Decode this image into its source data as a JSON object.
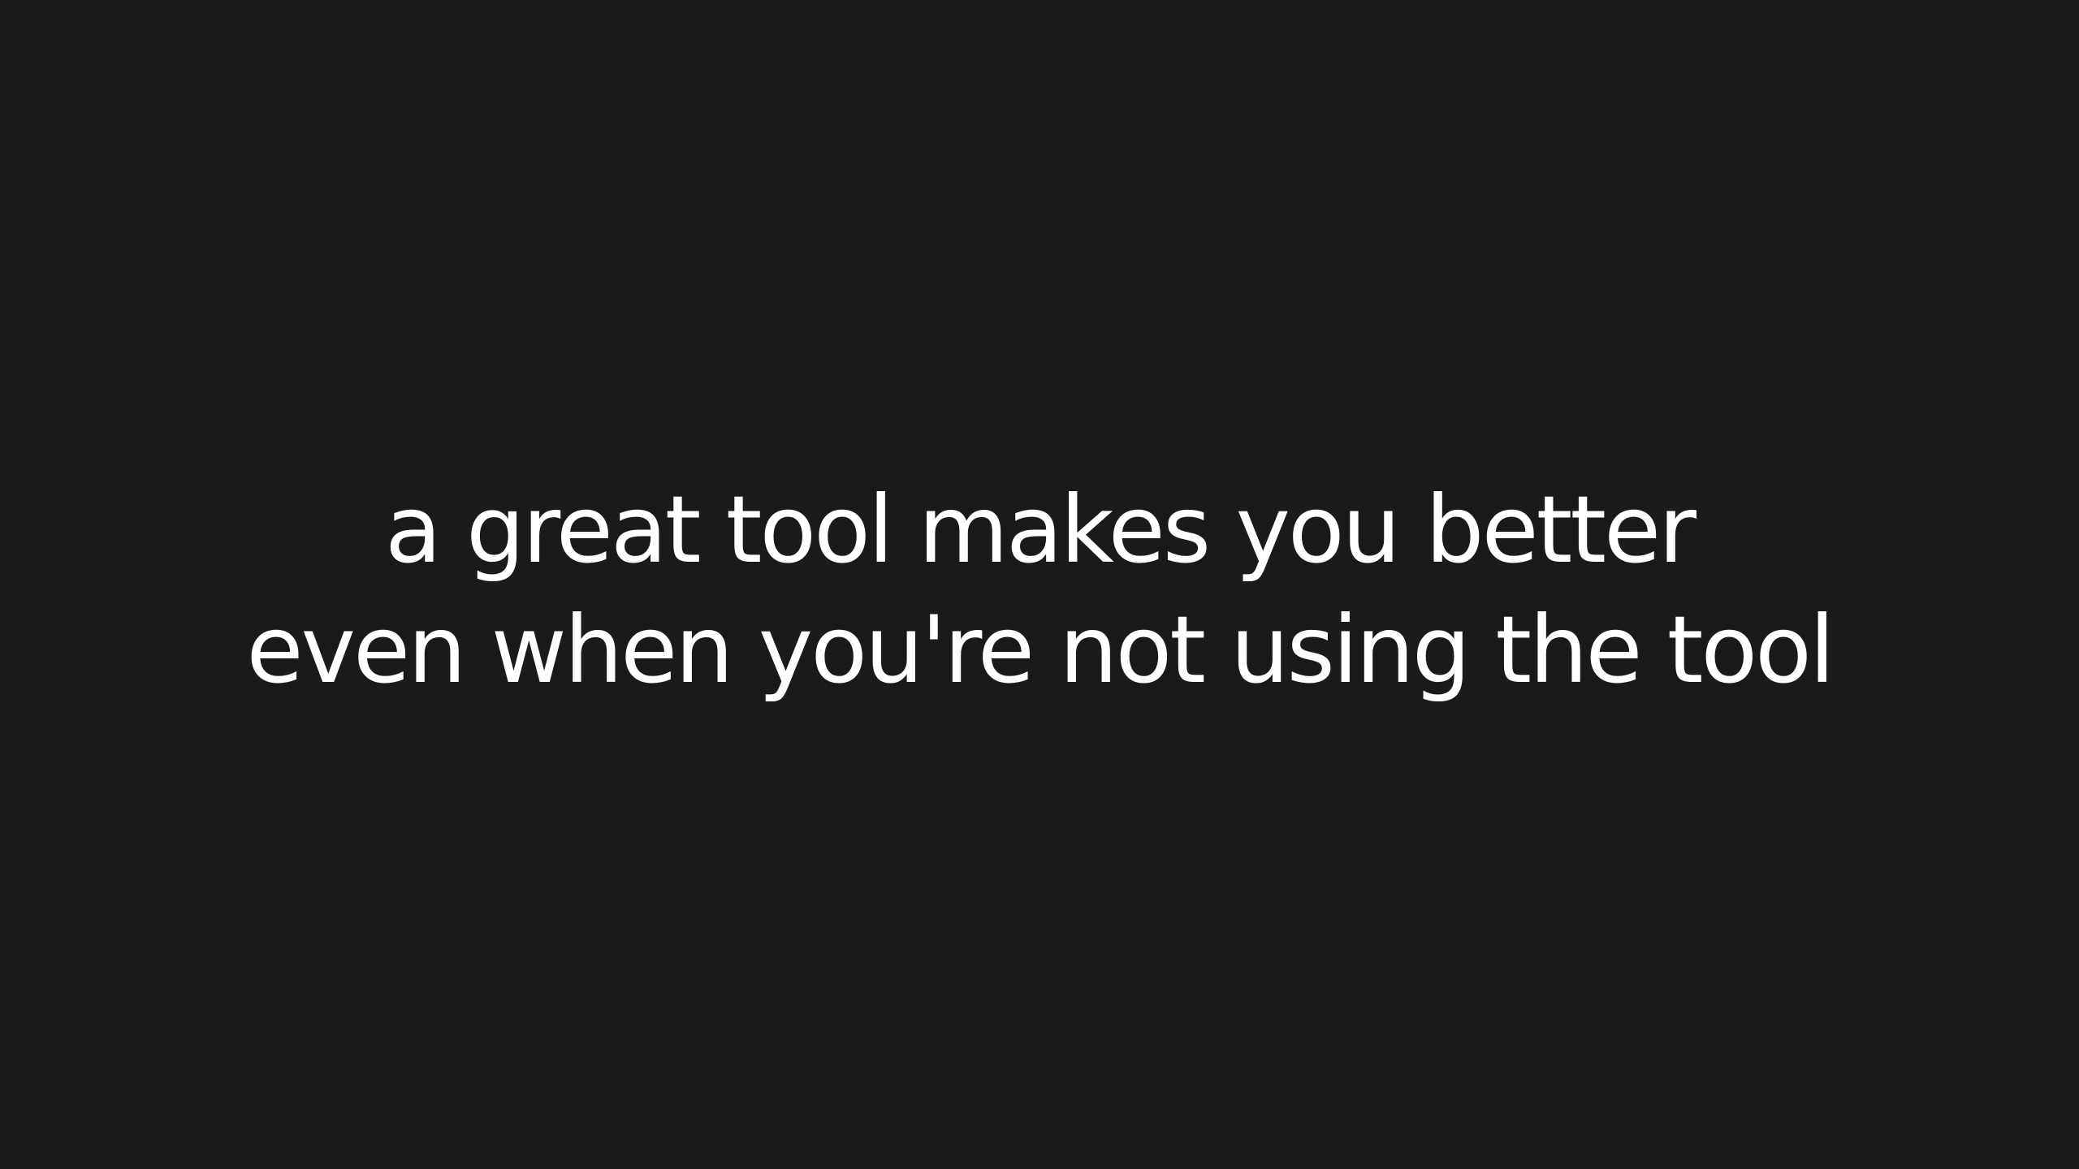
{
  "slide": {
    "background_color": "#1a1a1a",
    "text_color": "#ffffff",
    "quote_lines": [
      "a great tool makes you better",
      "even when you're not using the tool"
    ]
  }
}
